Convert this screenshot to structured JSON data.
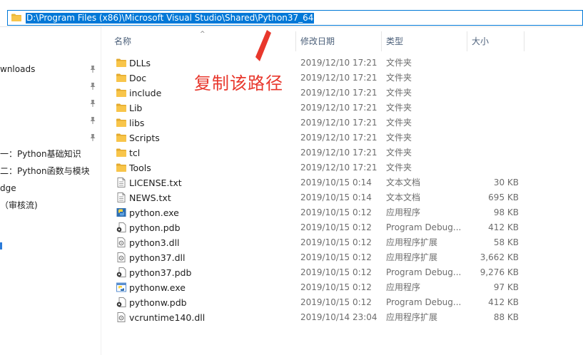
{
  "address_bar": {
    "path": "D:\\Program Files (x86)\\Microsoft Visual Studio\\Shared\\Python37_64"
  },
  "nav_pane": {
    "items": [
      {
        "label": "wnloads",
        "pinned": true
      },
      {
        "label": "",
        "pinned": true
      },
      {
        "label": "",
        "pinned": true
      },
      {
        "label": "",
        "pinned": true
      },
      {
        "label": "",
        "pinned": true
      },
      {
        "label": "一：Python基础知识",
        "pinned": false
      },
      {
        "label": "二：Python函数与模块",
        "pinned": false
      },
      {
        "label": "dge",
        "pinned": false
      },
      {
        "label": "（审核流)",
        "pinned": false
      }
    ]
  },
  "columns": {
    "name": "名称",
    "date": "修改日期",
    "type": "类型",
    "size": "大小"
  },
  "annotation": {
    "text": "复制该路径",
    "color": "#e8372c"
  },
  "files": [
    {
      "name": "DLLs",
      "date": "2019/12/10 17:21",
      "type": "文件夹",
      "size": "",
      "icon": "folder"
    },
    {
      "name": "Doc",
      "date": "2019/12/10 17:21",
      "type": "文件夹",
      "size": "",
      "icon": "folder"
    },
    {
      "name": "include",
      "date": "2019/12/10 17:21",
      "type": "文件夹",
      "size": "",
      "icon": "folder"
    },
    {
      "name": "Lib",
      "date": "2019/12/10 17:21",
      "type": "文件夹",
      "size": "",
      "icon": "folder"
    },
    {
      "name": "libs",
      "date": "2019/12/10 17:21",
      "type": "文件夹",
      "size": "",
      "icon": "folder"
    },
    {
      "name": "Scripts",
      "date": "2019/12/10 17:21",
      "type": "文件夹",
      "size": "",
      "icon": "folder"
    },
    {
      "name": "tcl",
      "date": "2019/12/10 17:21",
      "type": "文件夹",
      "size": "",
      "icon": "folder"
    },
    {
      "name": "Tools",
      "date": "2019/12/10 17:21",
      "type": "文件夹",
      "size": "",
      "icon": "folder"
    },
    {
      "name": "LICENSE.txt",
      "date": "2019/10/15 0:14",
      "type": "文本文档",
      "size": "30 KB",
      "icon": "text"
    },
    {
      "name": "NEWS.txt",
      "date": "2019/10/15 0:14",
      "type": "文本文档",
      "size": "695 KB",
      "icon": "text"
    },
    {
      "name": "python.exe",
      "date": "2019/10/15 0:12",
      "type": "应用程序",
      "size": "98 KB",
      "icon": "python-exe"
    },
    {
      "name": "python.pdb",
      "date": "2019/10/15 0:12",
      "type": "Program Debug...",
      "size": "412 KB",
      "icon": "pdb"
    },
    {
      "name": "python3.dll",
      "date": "2019/10/15 0:12",
      "type": "应用程序扩展",
      "size": "58 KB",
      "icon": "dll"
    },
    {
      "name": "python37.dll",
      "date": "2019/10/15 0:12",
      "type": "应用程序扩展",
      "size": "3,662 KB",
      "icon": "dll"
    },
    {
      "name": "python37.pdb",
      "date": "2019/10/15 0:12",
      "type": "Program Debug...",
      "size": "9,276 KB",
      "icon": "pdb"
    },
    {
      "name": "pythonw.exe",
      "date": "2019/10/15 0:12",
      "type": "应用程序",
      "size": "97 KB",
      "icon": "pythonw-exe"
    },
    {
      "name": "pythonw.pdb",
      "date": "2019/10/15 0:12",
      "type": "Program Debug...",
      "size": "412 KB",
      "icon": "pdb"
    },
    {
      "name": "vcruntime140.dll",
      "date": "2019/10/14 23:04",
      "type": "应用程序扩展",
      "size": "88 KB",
      "icon": "dll"
    }
  ],
  "colors": {
    "selection": "#0078d7",
    "folder": "#f8c54a",
    "header_text": "#4c607a"
  }
}
